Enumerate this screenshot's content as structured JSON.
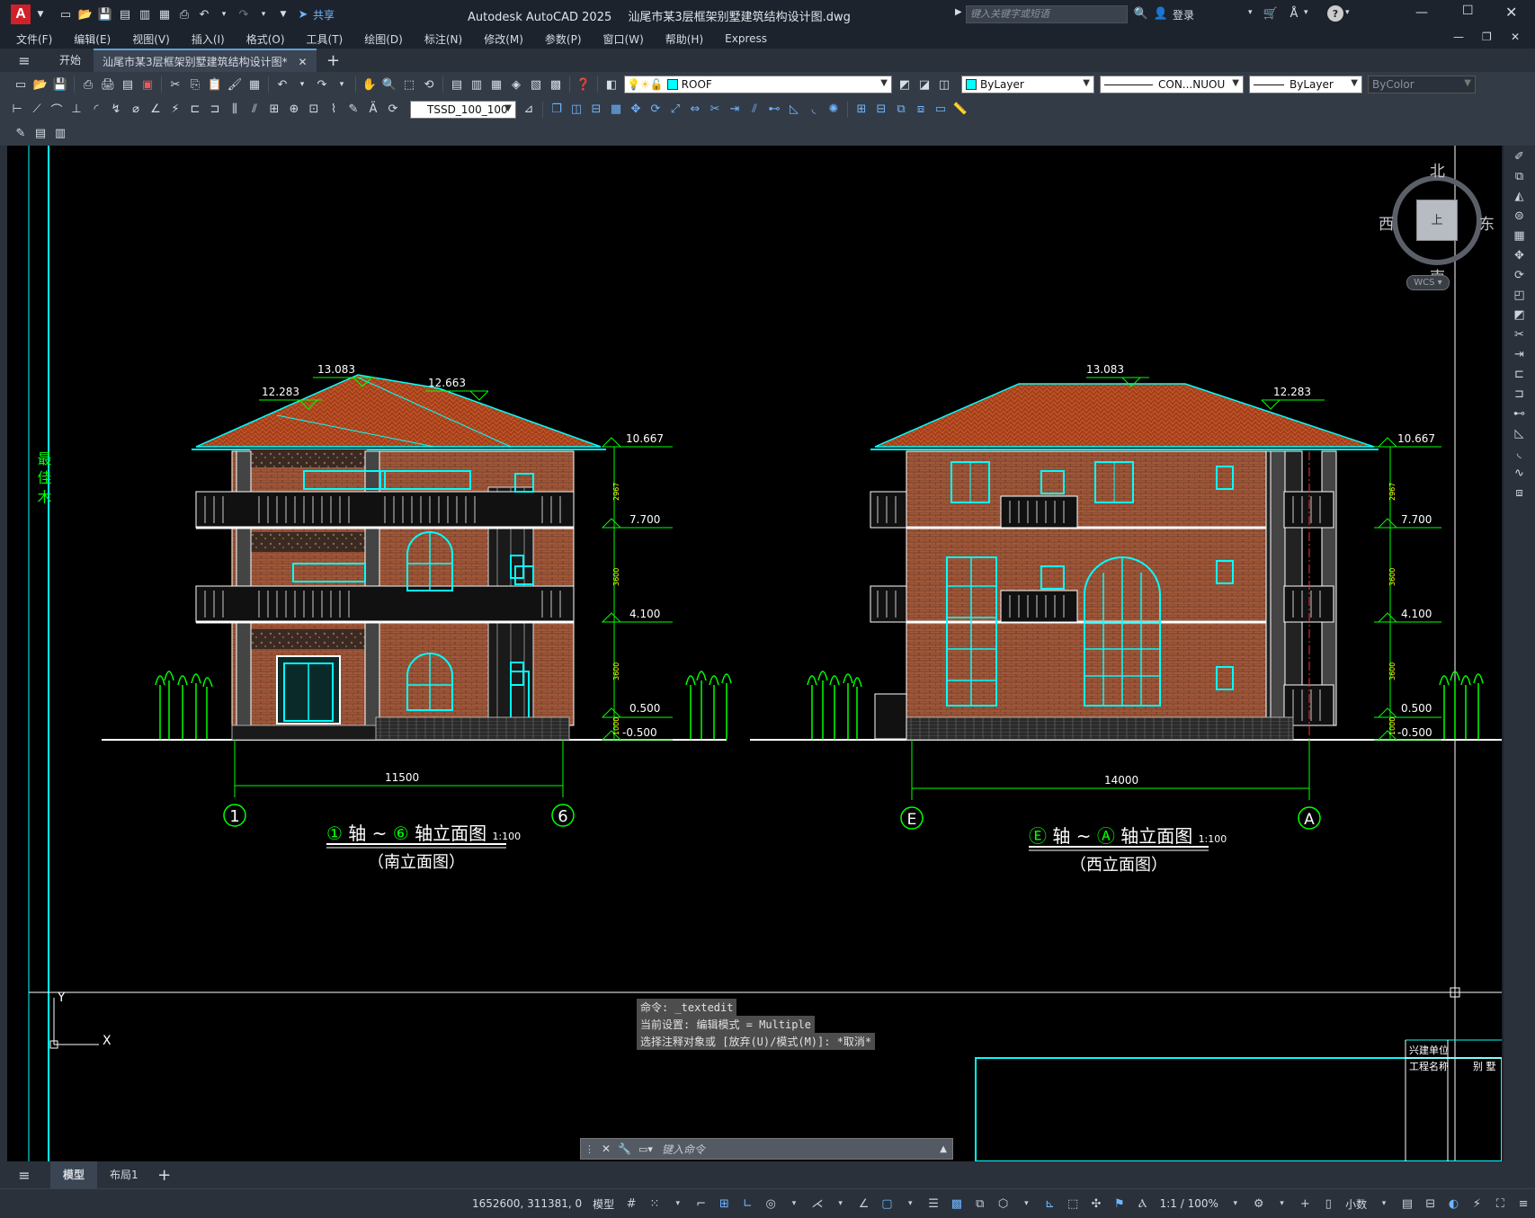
{
  "app": {
    "title": "Autodesk AutoCAD 2025",
    "document": "汕尾市某3层框架别墅建筑结构设计图.dwg",
    "search_placeholder": "键入关键字或短语",
    "login_label": "登录",
    "share_label": "共享",
    "logo_letter": "A"
  },
  "menu": {
    "items": [
      "文件(F)",
      "编辑(E)",
      "视图(V)",
      "插入(I)",
      "格式(O)",
      "工具(T)",
      "绘图(D)",
      "标注(N)",
      "修改(M)",
      "参数(P)",
      "窗口(W)",
      "帮助(H)",
      "Express"
    ]
  },
  "tabs": {
    "start": "开始",
    "active": "汕尾市某3层框架别墅建筑结构设计图*"
  },
  "properties": {
    "layer": "ROOF",
    "color": "ByLayer",
    "linetype": "CON...NUOU",
    "lineweight": "ByLayer",
    "plotstyle": "ByColor",
    "dimstyle": "TSSD_100_100"
  },
  "viewcube": {
    "north": "北",
    "south": "南",
    "east": "东",
    "west": "西",
    "face": "上",
    "wcs": "WCS"
  },
  "drawing": {
    "south": {
      "elev_top": "13.083",
      "elev_left": "12.283",
      "elev_right": "12.663",
      "elev_eave": "10.667",
      "elev_3f": "7.700",
      "elev_2f": "4.100",
      "elev_1f": "0.500",
      "elev_ground": "-0.500",
      "dim_a": "2967",
      "dim_b": "3600",
      "dim_c": "3600",
      "dim_d": "1000",
      "width": "11500",
      "axis_left": "1",
      "axis_right": "6",
      "title_axis_left": "①",
      "title_axis_right": "⑥",
      "title_part1": "轴",
      "title_tilde": "~",
      "title_part2": "轴立面图",
      "scale": "1:100",
      "subtitle": "（南立面图）"
    },
    "west": {
      "elev_top": "13.083",
      "elev_right": "12.283",
      "elev_eave": "10.667",
      "elev_3f": "7.700",
      "elev_2f": "4.100",
      "elev_1f": "0.500",
      "elev_ground": "-0.500",
      "dim_a": "2967",
      "dim_b": "3600",
      "dim_c": "3600",
      "dim_d": "1000",
      "width": "14000",
      "axis_left": "E",
      "axis_right": "A",
      "title_axis_left": "Ⓔ",
      "title_axis_right": "Ⓐ",
      "title_part1": "轴",
      "title_tilde": "~",
      "title_part2": "轴立面图",
      "scale": "1:100",
      "subtitle": "（西立面图）"
    },
    "titleblock": {
      "row1": "兴建单位",
      "row2": "工程名称",
      "row2b": "别 墅"
    },
    "ucs": {
      "y": "Y",
      "x": "X"
    },
    "left_vertical": "最 佳 木"
  },
  "command": {
    "lines": [
      "命令: _textedit",
      "当前设置: 编辑模式 = Multiple",
      "选择注释对象或 [放弃(U)/模式(M)]: *取消*"
    ],
    "placeholder": "键入命令"
  },
  "layouts": {
    "model": "模型",
    "layout1": "布局1"
  },
  "status": {
    "coords": "1652600, 311381, 0",
    "mode": "模型",
    "scale": "1:1 / 100%",
    "units": "小数"
  },
  "colors": {
    "canvas": "#000000",
    "cyan": "#00ffff",
    "green": "#00ff00",
    "roof": "#a0401a",
    "brick": "#a05a38",
    "ui_dark": "#1d232c"
  }
}
